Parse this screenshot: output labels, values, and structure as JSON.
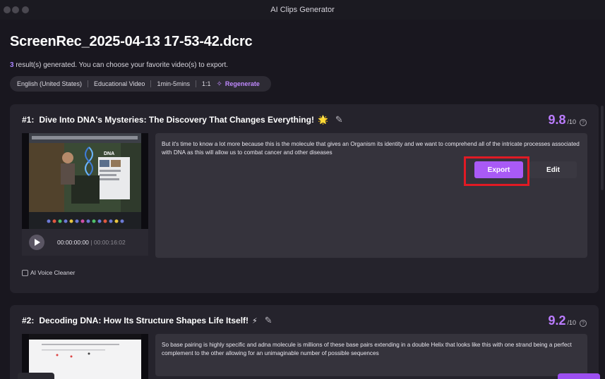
{
  "window": {
    "title": "AI Clips Generator"
  },
  "header": {
    "file_title": "ScreenRec_2025-04-13 17-53-42.dcrc",
    "result_count": "3",
    "result_text": " result(s) generated. You can choose your favorite video(s) to export."
  },
  "tags": {
    "language": "English (United States)",
    "category": "Educational Video",
    "duration": "1min-5mins",
    "ratio": "1:1",
    "regenerate_label": "Regenerate"
  },
  "clips": [
    {
      "number": "#1:",
      "title": "Dive Into DNA's Mysteries: The Discovery That Changes Everything!",
      "emoji": "🌟",
      "score": "9.8",
      "score_max": "/10",
      "transcript": "But it's time to know a lot more because this is the molecule that gives an Organism its identity and we want to comprehend all of the intricate processes associated with DNA as this will allow us to combat cancer and other diseases",
      "time_current": "00:00:00:00",
      "time_total": "00:00:16:02",
      "voice_cleaner_label": "AI Voice Cleaner",
      "voice_cleaner_checked": false,
      "thumbnail_text": "DNA",
      "export_label": "Export",
      "edit_label": "Edit"
    },
    {
      "number": "#2:",
      "title": "Decoding DNA: How Its Structure Shapes Life Itself!",
      "emoji": "⚡",
      "score": "9.2",
      "score_max": "/10",
      "transcript": "So base pairing is highly specific and adna molecule is millions of these base pairs extending in a double Helix that looks like this with one strand being a perfect complement to the other allowing for an unimaginable number of possible sequences"
    }
  ],
  "icons": {
    "edit_title": "pencil-icon",
    "help": "help-circle-icon",
    "play": "play-icon",
    "regenerate": "sparkle-icon"
  },
  "colors": {
    "accent": "#a95af6",
    "score": "#bb7cff",
    "highlight_outline": "#e01a24",
    "background": "#19171f",
    "card": "#25232c"
  }
}
